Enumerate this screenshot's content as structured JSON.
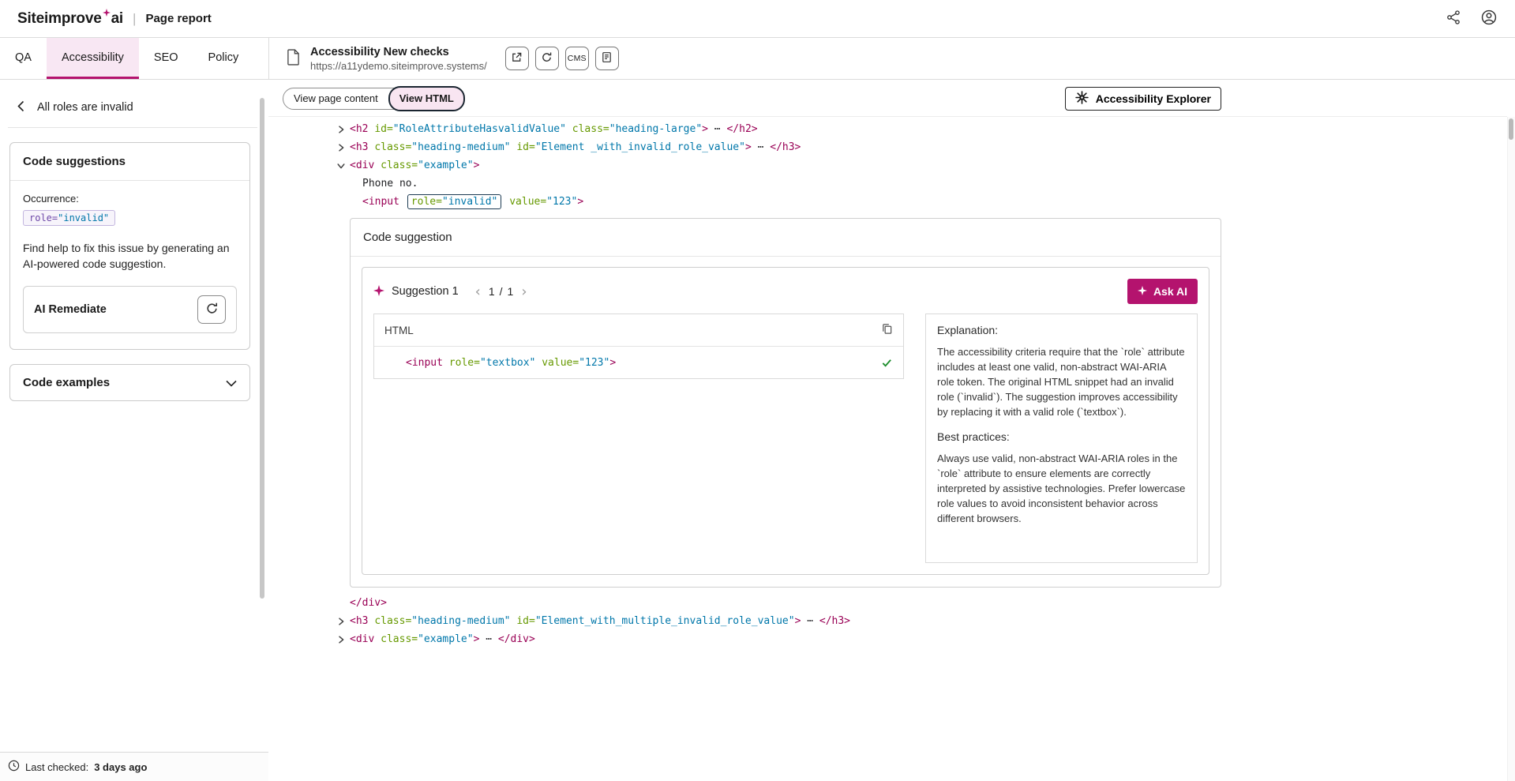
{
  "colors": {
    "accent": "#B4136E",
    "tag": "#990055",
    "attr": "#669900",
    "value": "#0077aa",
    "check": "#1E8E2E"
  },
  "header": {
    "brand": "Siteimprove",
    "brand_suffix": "ai",
    "separator": "|",
    "title": "Page report"
  },
  "tabs": [
    {
      "label": "QA"
    },
    {
      "label": "Accessibility"
    },
    {
      "label": "SEO"
    },
    {
      "label": "Policy"
    }
  ],
  "page_info": {
    "title": "Accessibility New checks",
    "url": "https://a11ydemo.siteimprove.systems/",
    "cms": "CMS"
  },
  "toolbar": {
    "view_page_content": "View page content",
    "view_html": "View HTML",
    "explorer": "Accessibility Explorer"
  },
  "sidebar": {
    "back": "All roles are invalid",
    "suggestions_title": "Code suggestions",
    "occurrence_label": "Occurrence:",
    "occurrence_attr": "role=",
    "occurrence_value": "\"invalid\"",
    "help_text": "Find help to fix this issue by generating an AI-powered code suggestion.",
    "ai_remediate": "AI Remediate",
    "code_examples": "Code examples",
    "last_checked_label": "Last checked:",
    "last_checked_value": "3 days ago"
  },
  "suggestion": {
    "card_title": "Code suggestion",
    "label": "Suggestion 1",
    "page_current": "1",
    "page_sep": "/",
    "page_total": "1",
    "ask_ai": "Ask AI",
    "html_header": "HTML",
    "explanation_title": "Explanation:",
    "explanation_body": "The accessibility criteria require that the `role` attribute includes at least one valid, non-abstract WAI-ARIA role token. The original HTML snippet had an invalid role (`invalid`). The suggestion improves accessibility by replacing it with a valid role (`textbox`).",
    "best_practices_title": "Best practices:",
    "best_practices_body": "Always use valid, non-abstract WAI-ARIA roles in the `role` attribute to ensure elements are correctly interpreted by assistive technologies. Prefer lowercase role values to avoid inconsistent behavior across different browsers."
  },
  "code_view": {
    "lines_before": [
      {
        "arrow": "collapsed",
        "indent": 0,
        "tokens": [
          {
            "t": "tag",
            "x": "<h2"
          },
          {
            "t": "plain",
            "x": " "
          },
          {
            "t": "attr",
            "x": "id="
          },
          {
            "t": "val",
            "x": "\"RoleAttributeHasvalidValue\""
          },
          {
            "t": "plain",
            "x": " "
          },
          {
            "t": "attr",
            "x": "class="
          },
          {
            "t": "val",
            "x": "\"heading-large\""
          },
          {
            "t": "tag",
            "x": ">"
          },
          {
            "t": "dots",
            "x": " ⋯ "
          },
          {
            "t": "tag",
            "x": "</h2>"
          }
        ]
      },
      {
        "arrow": "collapsed",
        "indent": 0,
        "tokens": [
          {
            "t": "tag",
            "x": "<h3"
          },
          {
            "t": "plain",
            "x": " "
          },
          {
            "t": "attr",
            "x": "class="
          },
          {
            "t": "val",
            "x": "\"heading-medium\""
          },
          {
            "t": "plain",
            "x": " "
          },
          {
            "t": "attr",
            "x": "id="
          },
          {
            "t": "val",
            "x": "\"Element _with_invalid_role_value\""
          },
          {
            "t": "tag",
            "x": ">"
          },
          {
            "t": "dots",
            "x": " ⋯ "
          },
          {
            "t": "tag",
            "x": "</h3>"
          }
        ]
      },
      {
        "arrow": "expanded",
        "indent": 0,
        "tokens": [
          {
            "t": "tag",
            "x": "<div"
          },
          {
            "t": "plain",
            "x": " "
          },
          {
            "t": "attr",
            "x": "class="
          },
          {
            "t": "val",
            "x": "\"example\""
          },
          {
            "t": "tag",
            "x": ">"
          }
        ]
      },
      {
        "indent": 1,
        "tokens": [
          {
            "t": "plain",
            "x": "Phone no."
          }
        ]
      },
      {
        "indent": 1,
        "tokens": [
          {
            "t": "tag",
            "x": "<input"
          },
          {
            "t": "plain",
            "x": " "
          },
          {
            "t": "boxed",
            "parts": [
              {
                "t": "attr",
                "x": "role="
              },
              {
                "t": "val",
                "x": "\"invalid\""
              }
            ]
          },
          {
            "t": "plain",
            "x": " "
          },
          {
            "t": "attr",
            "x": "value="
          },
          {
            "t": "val",
            "x": "\"123\""
          },
          {
            "t": "tag",
            "x": ">"
          }
        ]
      }
    ],
    "lines_after": [
      {
        "indent": 0,
        "tokens": [
          {
            "t": "tag",
            "x": "</div>"
          }
        ]
      },
      {
        "arrow": "collapsed",
        "indent": 0,
        "tokens": [
          {
            "t": "tag",
            "x": "<h3"
          },
          {
            "t": "plain",
            "x": " "
          },
          {
            "t": "attr",
            "x": "class="
          },
          {
            "t": "val",
            "x": "\"heading-medium\""
          },
          {
            "t": "plain",
            "x": " "
          },
          {
            "t": "attr",
            "x": "id="
          },
          {
            "t": "val",
            "x": "\"Element_with_multiple_invalid_role_value\""
          },
          {
            "t": "tag",
            "x": ">"
          },
          {
            "t": "dots",
            "x": " ⋯ "
          },
          {
            "t": "tag",
            "x": "</h3>"
          }
        ]
      },
      {
        "arrow": "collapsed",
        "indent": 0,
        "tokens": [
          {
            "t": "tag",
            "x": "<div"
          },
          {
            "t": "plain",
            "x": " "
          },
          {
            "t": "attr",
            "x": "class="
          },
          {
            "t": "val",
            "x": "\"example\""
          },
          {
            "t": "tag",
            "x": ">"
          },
          {
            "t": "dots",
            "x": " ⋯ "
          },
          {
            "t": "tag",
            "x": "</div>"
          }
        ]
      }
    ],
    "suggestion_code": [
      {
        "t": "tag",
        "x": "<input"
      },
      {
        "t": "plain",
        "x": " "
      },
      {
        "t": "attr",
        "x": "role="
      },
      {
        "t": "val",
        "x": "\"textbox\""
      },
      {
        "t": "plain",
        "x": " "
      },
      {
        "t": "attr",
        "x": "value="
      },
      {
        "t": "val",
        "x": "\"123\""
      },
      {
        "t": "tag",
        "x": ">"
      }
    ]
  }
}
